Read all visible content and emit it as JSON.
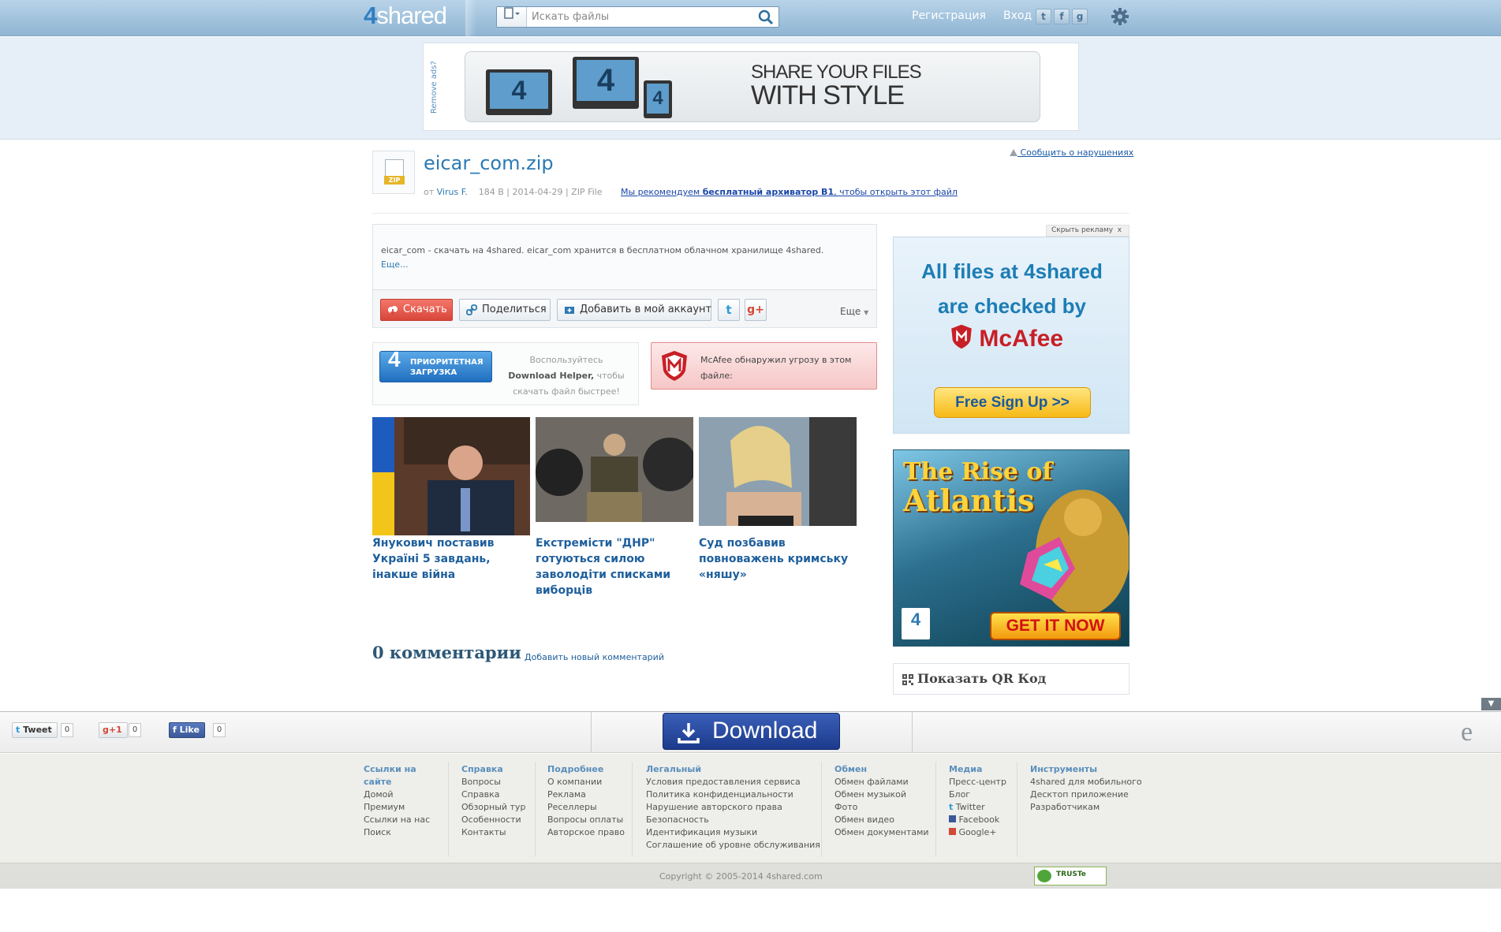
{
  "header": {
    "logo": "4shared",
    "search_placeholder": "Искать файлы",
    "register": "Регистрация",
    "login": "Вход",
    "social": [
      "twitter",
      "facebook",
      "google"
    ]
  },
  "banner": {
    "remove_ads": "Remove ads?",
    "slogan_line1": "SHARE YOUR FILES",
    "slogan_line2": "WITH STYLE"
  },
  "file": {
    "name": "eicar_com.zip",
    "badge": "ZIP",
    "author_prefix": "от",
    "author": "Virus F.",
    "size": "184 B",
    "date": "2014-04-29",
    "type": "ZIP File",
    "recommend_prefix": "Мы рекомендуем ",
    "recommend_link": "бесплатный архиватор B1",
    "recommend_suffix": ", чтобы открыть этот файл",
    "report": "Сообщить о нарушениях"
  },
  "description": {
    "text": "eicar_com - скачать на 4shared. eicar_com хранится в бесплатном облачном хранилище 4shared.",
    "more": "Еще..."
  },
  "actions": {
    "download": "Скачать",
    "share": "Поделиться",
    "add_account": "Добавить в мой аккаунт",
    "more": "Еще"
  },
  "priority": {
    "button_line1": "ПРИОРИТЕТНАЯ",
    "button_line2": "ЗАГРУЗКА",
    "text_line1": "Воспользуйтесь",
    "text_bold": "Download Helper,",
    "text_after": " чтобы",
    "text_line3": "скачать файл быстрее!"
  },
  "threat": {
    "line1": "McAfee обнаружил угрозу в этом",
    "line2": "файле:"
  },
  "news": [
    {
      "caption": "Янукович поставив Україні 5 завдань, інакше війна"
    },
    {
      "caption": "Екстремісти \"ДНР\" готуються силою заволодіти списками виборців"
    },
    {
      "caption": "Суд позбавив повноважень кримську «няшу»"
    }
  ],
  "comments": {
    "title": "0 комментарии",
    "add": "Добавить новый комментарий"
  },
  "sidebar": {
    "hide_ad": "Скрыть рекламу",
    "hide_ad_x": "x",
    "ad1_line1": "All files at 4shared",
    "ad1_line2": "are checked by",
    "ad1_brand": "McAfee",
    "ad1_cta": "Free Sign Up >>",
    "ad2_title1": "The Rise of",
    "ad2_title2": "Atlantis",
    "ad2_cta": "GET IT NOW",
    "ad2_badge": "4",
    "qr": "Показать QR Код"
  },
  "bottom_bar": {
    "tweet": "Tweet",
    "tweet_count": "0",
    "gplus": "+1",
    "gplus_count": "0",
    "like": "Like",
    "like_count": "0",
    "download": "Download"
  },
  "footer": {
    "columns": [
      {
        "title": "Ссылки на сайте",
        "items": [
          "Домой",
          "Премиум",
          "Ссылки на нас",
          "Поиск"
        ]
      },
      {
        "title": "Справка",
        "items": [
          "Вопросы",
          "Справка",
          "Обзорный тур",
          "Особенности",
          "Контакты"
        ]
      },
      {
        "title": "Подробнее",
        "items": [
          "О компании",
          "Реклама",
          "Реселлеры",
          "Вопросы оплаты",
          "Авторское право"
        ]
      },
      {
        "title": "Легальный",
        "items": [
          "Условия предоставления сервиса",
          "Политика конфиденциальности",
          "Нарушение авторского права",
          "Безопасность",
          "Идентификация музыки",
          "Соглашение об уровне обслуживания"
        ]
      },
      {
        "title": "Обмен",
        "items": [
          "Обмен файлами",
          "Обмен музыкой",
          "Фото",
          "Обмен видео",
          "Обмен документами"
        ]
      },
      {
        "title": "Медиа",
        "items": [
          "Пресс-центр",
          "Блог",
          "Twitter",
          "Facebook",
          "Google+"
        ]
      },
      {
        "title": "Инструменты",
        "items": [
          "4shared для мобильного",
          "Десктоп приложение",
          "Разработчикам"
        ]
      }
    ],
    "copyright": "Copyright © 2005-2014 4shared.com",
    "truste": "TRUSTe"
  },
  "colors": {
    "accent": "#2c7ab3",
    "download_red": "#d9453a",
    "mcafee_red": "#c81f26"
  }
}
